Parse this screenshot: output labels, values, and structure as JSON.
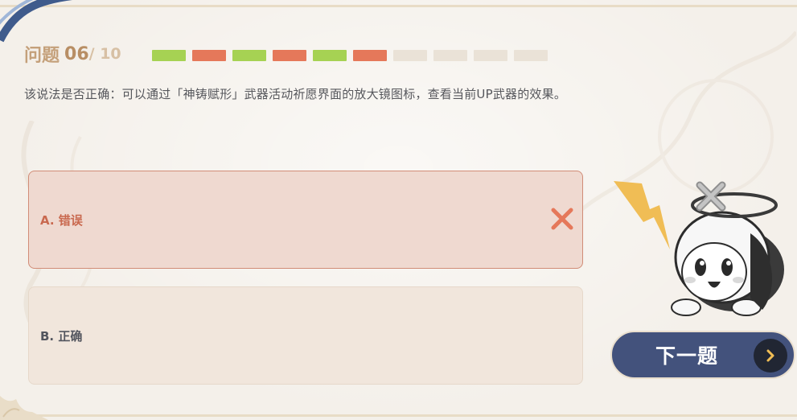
{
  "header": {
    "question_label": "问题",
    "question_number": "06",
    "question_total": "/ 10"
  },
  "progress": {
    "segments": [
      "correct",
      "wrong",
      "correct",
      "wrong",
      "correct",
      "wrong",
      "pending",
      "pending",
      "pending",
      "pending"
    ],
    "colors": {
      "correct": "#a6d253",
      "wrong": "#e5785a",
      "pending": "#eae2d7"
    }
  },
  "question": {
    "text": "该说法是否正确：可以通过「神铸赋形」武器活动祈愿界面的放大镜图标，查看当前UP武器的效果。"
  },
  "options": [
    {
      "label": "A. 错误",
      "state": "selected-wrong",
      "icon": "cross-icon"
    },
    {
      "label": "B. 正确",
      "state": "unselected"
    }
  ],
  "next_button": {
    "label": "下一题",
    "icon": "chevron-right-icon",
    "accent": "#43527c"
  },
  "mascot": {
    "icon": "paimon-mascot-icon"
  }
}
